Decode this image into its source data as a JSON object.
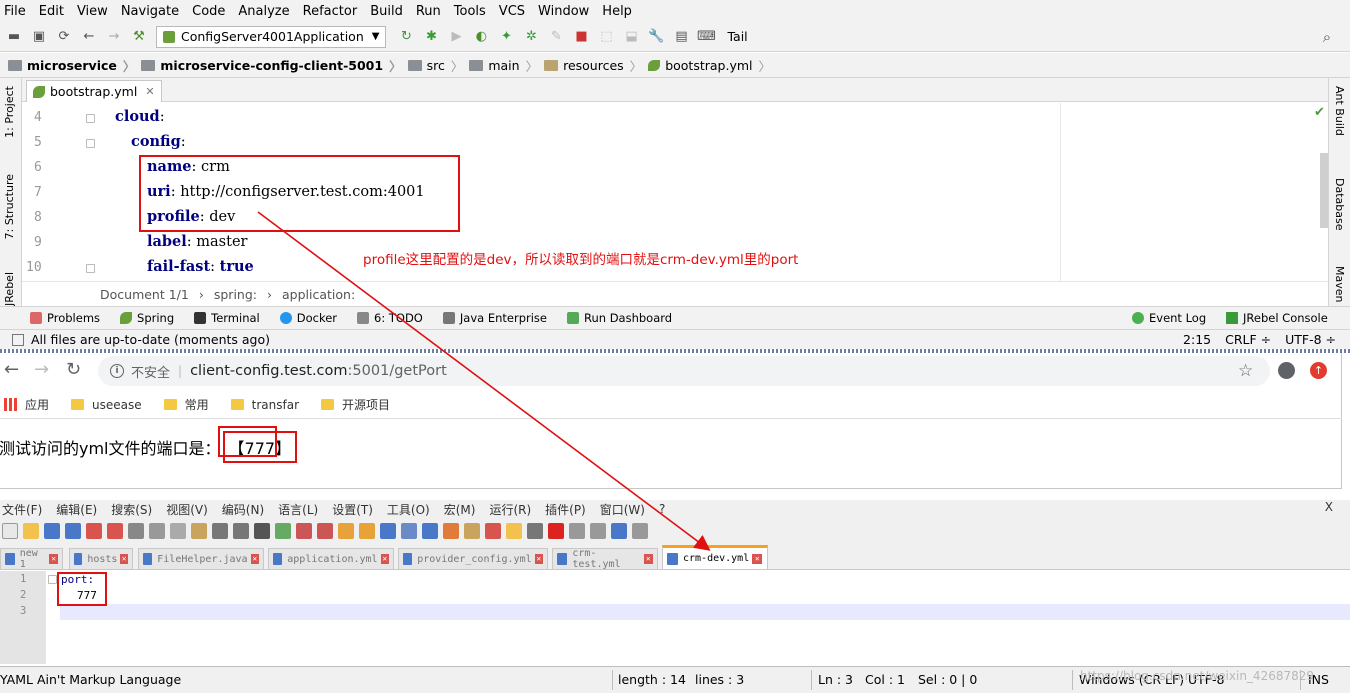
{
  "ide": {
    "menu": [
      "File",
      "Edit",
      "View",
      "Navigate",
      "Code",
      "Analyze",
      "Refactor",
      "Build",
      "Run",
      "Tools",
      "VCS",
      "Window",
      "Help"
    ],
    "run_config": "ConfigServer4001Application",
    "tail_label": "Tail",
    "breadcrumbs": [
      "microservice",
      "microservice-config-client-5001",
      "src",
      "main",
      "resources",
      "bootstrap.yml"
    ],
    "file_tab": "bootstrap.yml",
    "left_tools": [
      "1: Project",
      "7: Structure",
      "JRebel"
    ],
    "right_tools": [
      "Ant Build",
      "Database",
      "Maven"
    ],
    "code_lines": [
      {
        "num": "4",
        "key": "cloud",
        "value": ""
      },
      {
        "num": "5",
        "key": "config",
        "value": ""
      },
      {
        "num": "6",
        "key": "name",
        "value": "crm"
      },
      {
        "num": "7",
        "key": "uri",
        "value": "http://configserver.test.com:4001"
      },
      {
        "num": "8",
        "key": "profile",
        "value": "dev"
      },
      {
        "num": "9",
        "key": "label",
        "value": "master"
      },
      {
        "num": "10",
        "key": "fail-fast",
        "value": "true"
      }
    ],
    "doc_path": [
      "Document 1/1",
      "spring:",
      "application:"
    ],
    "bottom_tools": [
      "Problems",
      "Spring",
      "Terminal",
      "Docker",
      "6: TODO",
      "Java Enterprise",
      "Run Dashboard"
    ],
    "bottom_right": [
      "Event Log",
      "JRebel Console"
    ],
    "status_text": "All files are up-to-date (moments ago)",
    "status_right": [
      "2:15",
      "CRLF ÷",
      "UTF-8 ÷"
    ]
  },
  "browser": {
    "insecure": "不安全",
    "url_host": "client-config.test.com",
    "url_rest": ":5001/getPort",
    "bookmarks": [
      "应用",
      "useease",
      "常用",
      "transfar",
      "开源项目"
    ],
    "page_text": "测试访问的yml文件的端口是：",
    "page_port": "【777】"
  },
  "notepad": {
    "menu": [
      "文件(F)",
      "编辑(E)",
      "搜索(S)",
      "视图(V)",
      "编码(N)",
      "语言(L)",
      "设置(T)",
      "工具(O)",
      "宏(M)",
      "运行(R)",
      "插件(P)",
      "窗口(W)",
      "?"
    ],
    "close": "X",
    "tabs": [
      "new 1",
      "hosts",
      "FileHelper.java",
      "application.yml",
      "provider_config.yml",
      "crm-test.yml",
      "crm-dev.yml"
    ],
    "line_numbers": [
      "1",
      "2",
      "3"
    ],
    "line1": "port:",
    "line2": "777",
    "status": {
      "language": "YAML Ain't Markup Language",
      "length": "length : 14",
      "lines": "lines : 3",
      "ln": "Ln : 3",
      "col": "Col : 1",
      "sel": "Sel : 0 | 0",
      "eol": "Windows (CR LF)",
      "encoding": "UTF-8",
      "mode": "INS"
    }
  },
  "annotation": "profile这里配置的是dev，所以读取到的端口就是crm-dev.yml里的port",
  "watermark": "https://blog.csdn.net/weixin_42687829",
  "colors": {
    "annotation_red": "#e01010",
    "yaml_key": "#000080"
  }
}
